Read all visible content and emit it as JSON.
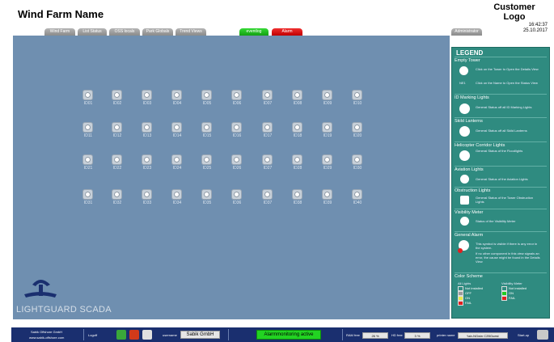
{
  "header": {
    "wind_farm_name": "Wind Farm Name",
    "customer_logo": "Customer Logo",
    "time": "16:42:37",
    "date": "25.10.2017"
  },
  "tabs": [
    {
      "label": "Wind Farm"
    },
    {
      "label": "List Status"
    },
    {
      "label": "OSS locals"
    },
    {
      "label": "Park Globals"
    },
    {
      "label": "Trend Views"
    }
  ],
  "status_tabs": {
    "eventlog": "eventlog",
    "alarm": "Alarm"
  },
  "admin_tab": "Administrator",
  "towers": [
    "ID01",
    "ID02",
    "ID03",
    "ID04",
    "ID05",
    "ID06",
    "ID07",
    "ID08",
    "ID09",
    "ID10",
    "ID11",
    "ID12",
    "ID13",
    "ID14",
    "ID15",
    "ID16",
    "ID17",
    "ID18",
    "ID19",
    "ID20",
    "ID21",
    "ID22",
    "ID23",
    "ID24",
    "ID25",
    "ID26",
    "ID27",
    "ID28",
    "ID29",
    "ID30",
    "ID31",
    "ID32",
    "ID33",
    "ID34",
    "ID35",
    "ID36",
    "ID37",
    "ID38",
    "ID39",
    "ID40"
  ],
  "brand": "LIGHTGUARD SCADA",
  "legend": {
    "title": "LEGEND",
    "empty_tower": {
      "heading": "Empty Tower",
      "text1": "Click on the Tower to Open the Details View",
      "text2": "Click on the Name to Open the Status View",
      "name_tag": "NE1"
    },
    "id_marking": {
      "heading": "ID Marking Lights",
      "text": "General Status off all ID Marking Lights"
    },
    "skid": {
      "heading": "Skild Lanterns",
      "text": "General Status off all Skild Lanterns"
    },
    "helicopter": {
      "heading": "Helicopter Corridor Lights",
      "text": "General Status of the Floodlights"
    },
    "aviation": {
      "heading": "Aviation Lights",
      "text": "General Status of the Aviation Lights"
    },
    "obstruction": {
      "heading": "Obstruction Lights",
      "text": "General Status of the Tower Obstruction Lights"
    },
    "visibility": {
      "heading": "Visibility Meter",
      "text": "Status of the Visibility Meter"
    },
    "alarm": {
      "heading": "General Alarm",
      "text1": "This symbol is visible if there is any error in the system.",
      "text2": "If no other component in this view signals an error, the cause might be found in the Details View"
    },
    "color_scheme": {
      "heading": "Color Scheme",
      "all_lights": "All Lights",
      "visibility_meter": "Visibility Meter",
      "left": [
        {
          "label": "Not installed",
          "color": "#2f8b80"
        },
        {
          "label": "OFF",
          "color": "#9a9a9a"
        },
        {
          "label": "ON",
          "color": "#e8e84a"
        },
        {
          "label": "FAIL",
          "color": "#e02020"
        }
      ],
      "right": [
        {
          "label": "Not installed",
          "color": "#2f8b80"
        },
        {
          "label": "ON",
          "color": "#22cc22"
        },
        {
          "label": "FAIL",
          "color": "#e02020"
        }
      ]
    }
  },
  "footer": {
    "company": "Sabik Offshore GmbH",
    "website": "www.sabik-offshore.com",
    "logoff": "Logoff",
    "username_label": "username",
    "username": "Sabik GmbH",
    "alarm_status": "Alarmmonitoring active",
    "ram_label": "RAM free",
    "ram_value": "26 %",
    "hd_label": "HD free",
    "hd_value": "3 %",
    "printer_label": "printer name",
    "printer_value": "\\\\sb-NGwin C2BGuest",
    "startup": "Start-up"
  }
}
